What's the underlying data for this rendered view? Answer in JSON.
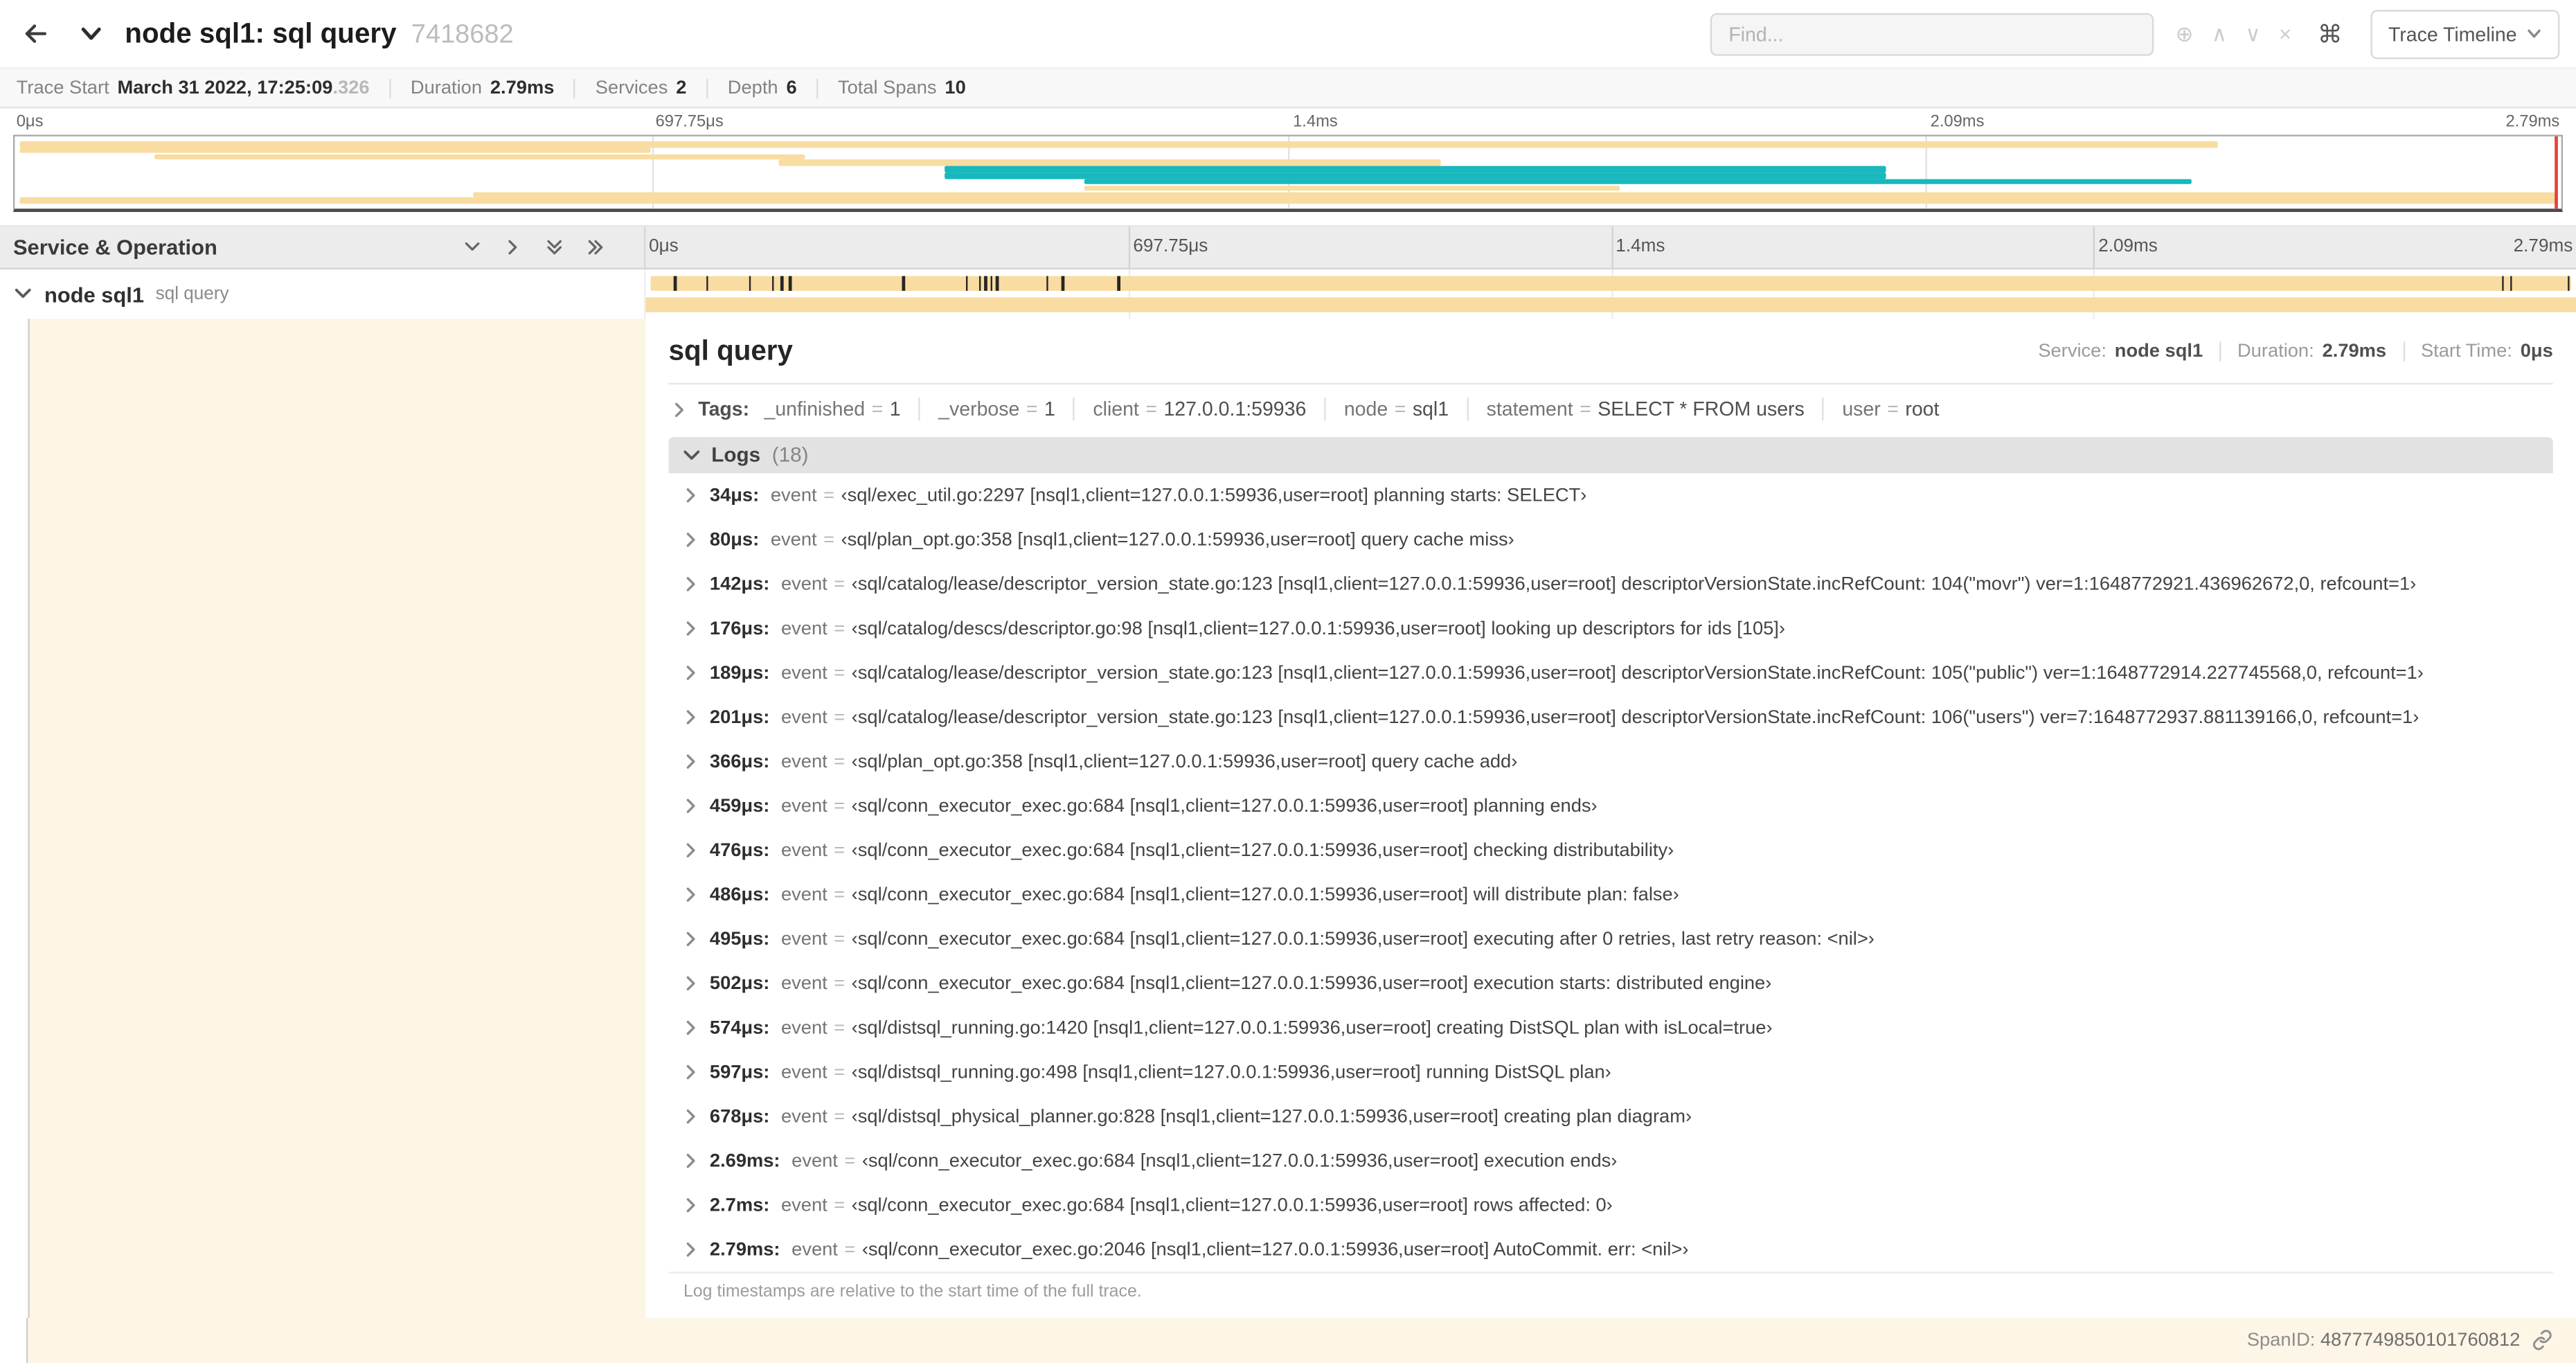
{
  "header": {
    "title": "node sql1: sql query",
    "trace_id": "7418682",
    "find_placeholder": "Find...",
    "trace_timeline_label": "Trace Timeline"
  },
  "icons": {
    "zoom": "⊕",
    "prev": "∧",
    "next": "∨",
    "clear": "×",
    "command": "⌘"
  },
  "summary": {
    "items": [
      {
        "label": "Trace Start",
        "value": "March 31 2022, 17:25:09",
        "suffix": ".326"
      },
      {
        "label": "Duration",
        "value": "2.79ms",
        "suffix": ""
      },
      {
        "label": "Services",
        "value": "2",
        "suffix": ""
      },
      {
        "label": "Depth",
        "value": "6",
        "suffix": ""
      },
      {
        "label": "Total Spans",
        "value": "10",
        "suffix": ""
      }
    ]
  },
  "minimap": {
    "end_marker_color": "#e2453c",
    "spans": [
      {
        "start": 0.002,
        "end": 0.865,
        "color": "#F8DCA1"
      },
      {
        "start": 0.002,
        "end": 0.25,
        "color": "#F8DCA1"
      },
      {
        "start": 0.055,
        "end": 0.31,
        "color": "#F8DCA1"
      },
      {
        "start": 0.3,
        "end": 0.56,
        "color": "#F8DCA1"
      },
      {
        "start": 0.365,
        "end": 0.735,
        "color": "#17B8BE"
      },
      {
        "start": 0.365,
        "end": 0.735,
        "color": "#17B8BE"
      },
      {
        "start": 0.42,
        "end": 0.855,
        "color": "#17B8BE"
      },
      {
        "start": 0.42,
        "end": 0.63,
        "color": "#F8DCA1"
      },
      {
        "start": 0.18,
        "end": 0.998,
        "color": "#F8DCA1"
      },
      {
        "start": 0.002,
        "end": 0.998,
        "color": "#F8DCA1"
      }
    ]
  },
  "timeline": {
    "left_header": "Service & Operation",
    "ticks": [
      "0μs",
      "697.75μs",
      "1.4ms",
      "2.09ms",
      "2.79ms"
    ],
    "row": {
      "service": "node sql1",
      "operation": "sql query"
    },
    "span_color": "#F8DCA1",
    "bar_ticks": [
      0.012,
      0.029,
      0.051,
      0.063,
      0.068,
      0.072,
      0.131,
      0.164,
      0.171,
      0.174,
      0.177,
      0.18,
      0.206,
      0.214,
      0.243,
      0.964,
      0.968,
      0.998
    ]
  },
  "detail": {
    "title": "sql query",
    "meta": [
      {
        "label": "Service:",
        "value": "node sql1"
      },
      {
        "label": "Duration:",
        "value": "2.79ms"
      },
      {
        "label": "Start Time:",
        "value": "0μs"
      }
    ],
    "tags_label": "Tags:",
    "tags": [
      {
        "key": "_unfinished",
        "value": "1"
      },
      {
        "key": "_verbose",
        "value": "1"
      },
      {
        "key": "client",
        "value": "127.0.0.1:59936"
      },
      {
        "key": "node",
        "value": "sql1"
      },
      {
        "key": "statement",
        "value": "SELECT * FROM users"
      },
      {
        "key": "user",
        "value": "root"
      }
    ],
    "logs_label": "Logs",
    "logs_count": "(18)",
    "logs": [
      {
        "time": "34μs:",
        "key": "event",
        "value": "‹sql/exec_util.go:2297 [nsql1,client=127.0.0.1:59936,user=root] planning starts: SELECT›"
      },
      {
        "time": "80μs:",
        "key": "event",
        "value": "‹sql/plan_opt.go:358 [nsql1,client=127.0.0.1:59936,user=root] query cache miss›"
      },
      {
        "time": "142μs:",
        "key": "event",
        "value": "‹sql/catalog/lease/descriptor_version_state.go:123 [nsql1,client=127.0.0.1:59936,user=root] descriptorVersionState.incRefCount: 104(\"movr\") ver=1:1648772921.436962672,0, refcount=1›"
      },
      {
        "time": "176μs:",
        "key": "event",
        "value": "‹sql/catalog/descs/descriptor.go:98 [nsql1,client=127.0.0.1:59936,user=root] looking up descriptors for ids [105]›"
      },
      {
        "time": "189μs:",
        "key": "event",
        "value": "‹sql/catalog/lease/descriptor_version_state.go:123 [nsql1,client=127.0.0.1:59936,user=root] descriptorVersionState.incRefCount: 105(\"public\") ver=1:1648772914.227745568,0, refcount=1›"
      },
      {
        "time": "201μs:",
        "key": "event",
        "value": "‹sql/catalog/lease/descriptor_version_state.go:123 [nsql1,client=127.0.0.1:59936,user=root] descriptorVersionState.incRefCount: 106(\"users\") ver=7:1648772937.881139166,0, refcount=1›"
      },
      {
        "time": "366μs:",
        "key": "event",
        "value": "‹sql/plan_opt.go:358 [nsql1,client=127.0.0.1:59936,user=root] query cache add›"
      },
      {
        "time": "459μs:",
        "key": "event",
        "value": "‹sql/conn_executor_exec.go:684 [nsql1,client=127.0.0.1:59936,user=root] planning ends›"
      },
      {
        "time": "476μs:",
        "key": "event",
        "value": "‹sql/conn_executor_exec.go:684 [nsql1,client=127.0.0.1:59936,user=root] checking distributability›"
      },
      {
        "time": "486μs:",
        "key": "event",
        "value": "‹sql/conn_executor_exec.go:684 [nsql1,client=127.0.0.1:59936,user=root] will distribute plan: false›"
      },
      {
        "time": "495μs:",
        "key": "event",
        "value": "‹sql/conn_executor_exec.go:684 [nsql1,client=127.0.0.1:59936,user=root] executing after 0 retries, last retry reason: <nil>›"
      },
      {
        "time": "502μs:",
        "key": "event",
        "value": "‹sql/conn_executor_exec.go:684 [nsql1,client=127.0.0.1:59936,user=root] execution starts: distributed engine›"
      },
      {
        "time": "574μs:",
        "key": "event",
        "value": "‹sql/distsql_running.go:1420 [nsql1,client=127.0.0.1:59936,user=root] creating DistSQL plan with isLocal=true›"
      },
      {
        "time": "597μs:",
        "key": "event",
        "value": "‹sql/distsql_running.go:498 [nsql1,client=127.0.0.1:59936,user=root] running DistSQL plan›"
      },
      {
        "time": "678μs:",
        "key": "event",
        "value": "‹sql/distsql_physical_planner.go:828 [nsql1,client=127.0.0.1:59936,user=root] creating plan diagram›"
      },
      {
        "time": "2.69ms:",
        "key": "event",
        "value": "‹sql/conn_executor_exec.go:684 [nsql1,client=127.0.0.1:59936,user=root] execution ends›"
      },
      {
        "time": "2.7ms:",
        "key": "event",
        "value": "‹sql/conn_executor_exec.go:684 [nsql1,client=127.0.0.1:59936,user=root] rows affected: 0›"
      },
      {
        "time": "2.79ms:",
        "key": "event",
        "value": "‹sql/conn_executor_exec.go:2046 [nsql1,client=127.0.0.1:59936,user=root] AutoCommit. err: <nil>›"
      }
    ],
    "logs_note": "Log timestamps are relative to the start time of the full trace.",
    "span_id_label": "SpanID:",
    "span_id_value": "4877749850101760812"
  },
  "misc": {
    "eq": "="
  }
}
